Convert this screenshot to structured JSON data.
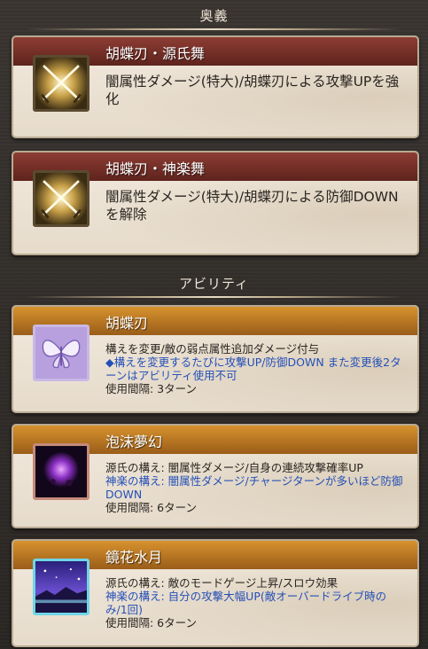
{
  "sections": {
    "ougi_title": "奥義",
    "ability_title": "アビリティ"
  },
  "ougi": [
    {
      "name": "胡蝶刃・源氏舞",
      "icon": "crossed-swords-icon",
      "desc": "闇属性ダメージ(特大)/胡蝶刃による攻撃UPを強化"
    },
    {
      "name": "胡蝶刃・神楽舞",
      "icon": "crossed-swords-icon",
      "desc": "闇属性ダメージ(特大)/胡蝶刃による防御DOWNを解除"
    }
  ],
  "abilities": [
    {
      "name": "胡蝶刃",
      "icon": "butterfly-icon",
      "line1": "構えを変更/敵の弱点属性追加ダメージ付与",
      "line2": "◆構えを変更するたびに攻撃UP/防御DOWN また変更後2ターンはアビリティ使用不可",
      "cooldown": "使用間隔: 3ターン"
    },
    {
      "name": "泡沫夢幻",
      "icon": "purple-moon-icon",
      "line1": "源氏の構え: 闇属性ダメージ/自身の連続攻撃確率UP",
      "line2": "神楽の構え: 闇属性ダメージ/チャージターンが多いほど防御DOWN",
      "cooldown": "使用間隔: 6ターン"
    },
    {
      "name": "鏡花水月",
      "icon": "night-sky-icon",
      "line1": "源氏の構え: 敵のモードゲージ上昇/スロウ効果",
      "line2": "神楽の構え: 自分の攻撃大幅UP(敵オーバードライブ時のみ/1回)",
      "cooldown": "使用間隔: 6ターン"
    }
  ],
  "colors": {
    "ougi_bar": "#6e2a22",
    "ability_bar": "#c27f27",
    "highlight_text": "#2450b8"
  }
}
